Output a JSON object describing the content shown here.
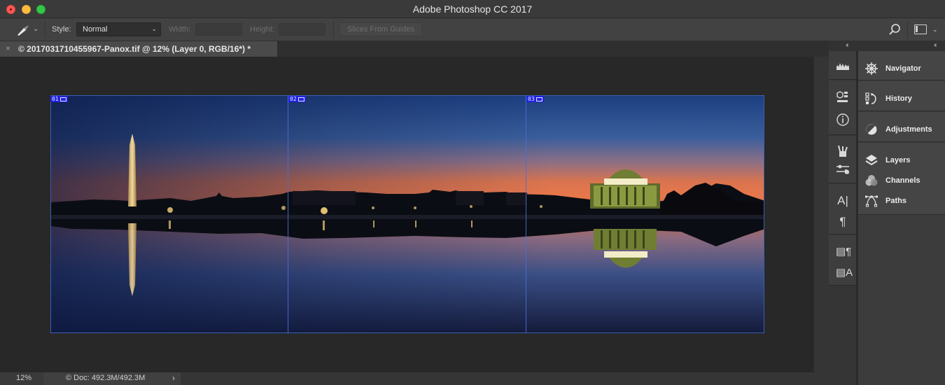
{
  "window": {
    "title": "Adobe Photoshop CC 2017"
  },
  "options_bar": {
    "tool": "slice-tool",
    "style_label": "Style:",
    "style_value": "Normal",
    "width_label": "Width:",
    "width_value": "",
    "height_label": "Height:",
    "height_value": "",
    "slices_button": "Slices From Guides"
  },
  "document_tab": {
    "close_glyph": "×",
    "title": "© 20170317104559​67-Panox.tif @ 12% (Layer 0, RGB/16*) *"
  },
  "canvas": {
    "slices": [
      {
        "id": "01"
      },
      {
        "id": "02"
      },
      {
        "id": "03"
      }
    ],
    "colors": {
      "sky_top": "#1d3f80",
      "sky_mid": "#3a5e9c",
      "sunset": "#e8774a",
      "water_bottom": "#141a3a",
      "slice_line": "#4a6ed0",
      "slice_badge": "#2222dd"
    }
  },
  "status_bar": {
    "zoom": "12%",
    "doc_info": "© Doc: 492.3M/492.3M",
    "chevron": "›"
  },
  "collapse_glyph": "‹‹",
  "icon_column": [
    {
      "name": "histogram-icon"
    },
    {
      "name": "properties-icon"
    },
    {
      "name": "info-icon"
    },
    {
      "name": "brushes-icon"
    },
    {
      "name": "brush-settings-icon"
    },
    {
      "name": "character-icon"
    },
    {
      "name": "paragraph-icon"
    },
    {
      "name": "paragraph-styles-icon"
    },
    {
      "name": "character-styles-icon"
    }
  ],
  "panels": [
    {
      "label": "Navigator",
      "icon": "navigator-icon"
    },
    {
      "label": "History",
      "icon": "history-icon"
    },
    {
      "label": "Adjustments",
      "icon": "adjustments-icon"
    },
    {
      "label": "Layers",
      "icon": "layers-icon"
    },
    {
      "label": "Channels",
      "icon": "channels-icon"
    },
    {
      "label": "Paths",
      "icon": "paths-icon"
    }
  ]
}
